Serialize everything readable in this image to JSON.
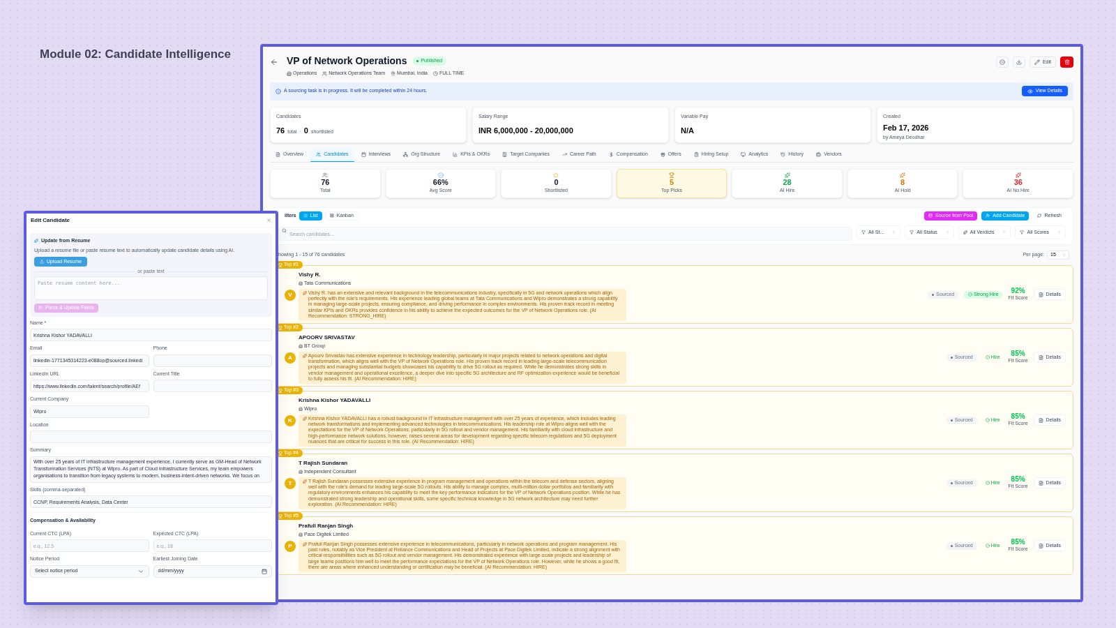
{
  "page_title": "Module 02: Candidate Intelligence",
  "job": {
    "title": "VP of Network Operations",
    "status": "Published",
    "meta": [
      {
        "kind": "department",
        "text": "Operations"
      },
      {
        "kind": "team",
        "text": "Network Operations Team"
      },
      {
        "kind": "location",
        "text": "Mumbai, India"
      },
      {
        "kind": "type",
        "text": "FULL TIME"
      }
    ],
    "edit_label": "Edit"
  },
  "banner": {
    "text": "A sourcing task is in progress. It will be completed within 24 hours.",
    "button": "View Details"
  },
  "info_cards": [
    {
      "kind": "counts",
      "label": "Candidates",
      "total": "76",
      "total_label": "total",
      "separator": "·",
      "shortlisted": "0",
      "shortlisted_label": "shortlisted"
    },
    {
      "kind": "value",
      "label": "Salary Range",
      "value": "INR 6,000,000 - 20,000,000"
    },
    {
      "kind": "value",
      "label": "Variable Pay",
      "value": "N/A"
    },
    {
      "kind": "dated",
      "label": "Created",
      "value": "Feb 17, 2026",
      "sub": "by Ameya Deodhar"
    }
  ],
  "tabs": [
    {
      "label": "Overview",
      "selected": false
    },
    {
      "label": "Candidates",
      "selected": true
    },
    {
      "label": "Interviews",
      "selected": false
    },
    {
      "label": "Org Structure",
      "selected": false
    },
    {
      "label": "KPIs & OKRs",
      "selected": false
    },
    {
      "label": "Target Companies",
      "selected": false
    },
    {
      "label": "Career Path",
      "selected": false
    },
    {
      "label": "Compensation",
      "selected": false
    },
    {
      "label": "Offers",
      "selected": false
    },
    {
      "label": "Hiring Setup",
      "selected": false
    },
    {
      "label": "Analytics",
      "selected": false
    },
    {
      "label": "History",
      "selected": false
    },
    {
      "label": "Vendors",
      "selected": false
    }
  ],
  "stats": [
    {
      "kind": "total",
      "value": "76",
      "label": "Total",
      "color": "#111827",
      "highlighted": false
    },
    {
      "kind": "score",
      "value": "66%",
      "label": "Avg Score",
      "color": "#111827",
      "highlighted": false
    },
    {
      "kind": "shortlisted",
      "value": "0",
      "label": "Shortlisted",
      "color": "#111827",
      "highlighted": false
    },
    {
      "kind": "top",
      "value": "5",
      "label": "Top Picks",
      "color": "#ca8a04",
      "highlighted": true
    },
    {
      "kind": "ai",
      "value": "28",
      "label": "AI Hire",
      "color": "#16a34a",
      "highlighted": false
    },
    {
      "kind": "ai",
      "value": "8",
      "label": "AI Hold",
      "color": "#d97706",
      "highlighted": false
    },
    {
      "kind": "ai",
      "value": "36",
      "label": "AI No Hire",
      "color": "#dc2626",
      "highlighted": false
    }
  ],
  "toolbar": {
    "filters_label": "ilters",
    "views": [
      {
        "label": "List",
        "selected": true
      },
      {
        "label": "Kanban",
        "selected": false
      }
    ],
    "actions": [
      {
        "kind": "source",
        "label": "Source from Pool"
      },
      {
        "kind": "add",
        "label": "Add Candidate"
      },
      {
        "kind": "refresh",
        "label": "Refresh"
      }
    ],
    "search_placeholder": "Search candidates...",
    "filters": [
      {
        "kind": "plain",
        "label": "All St..."
      },
      {
        "kind": "plain",
        "label": "All Status"
      },
      {
        "kind": "ai",
        "label": "All Verdicts"
      },
      {
        "kind": "plain",
        "label": "All Scores"
      }
    ]
  },
  "showing": "howing 1 - 15 of 76 candidates",
  "per_page": {
    "label": "Per page:",
    "value": "15"
  },
  "candidates": [
    {
      "rank": "Top #1",
      "initial": "V",
      "name": "Vishy R.",
      "company": "Tata Communications",
      "summary": "Vishy R. has an extensive and relevant background in the telecommunications industry, specifically in 5G and network operations which align perfectly with the role's requirements. His experience leading global teams at Tata Communications and Wipro demonstrates a strong capability in managing large-scale projects, ensuring compliance, and driving performance in complex environments. His proven track record in meeting similar KPIs and OKRs provides confidence in his ability to achieve the expected outcomes for the VP of Network Operations role. (AI Recommendation: STRONG_HIRE)",
      "status": "Sourced",
      "verdict": "Strong Hire",
      "strong": true,
      "score": "92%",
      "score_label": "Fit Score",
      "details": "Details"
    },
    {
      "rank": "Top #2",
      "initial": "A",
      "name": "APOORV SRIVASTAV",
      "company": "BT Group",
      "summary": "Apoorv Srivastav has extensive experience in technology leadership, particularly in major projects related to network operations and digital transformation, which aligns well with the VP of Network Operations role. His proven track record in leading large-scale telecommunication projects and managing substantial budgets showcases his capability to drive 5G rollout as required. While he demonstrates strong skills in vendor management and operational excellence, a deeper dive into specific 5G architecture and RF optimization experience would be beneficial to fully assess his fit. (AI Recommendation: HIRE)",
      "status": "Sourced",
      "verdict": "Hire",
      "strong": false,
      "score": "85%",
      "score_label": "Fit Score",
      "details": "Details"
    },
    {
      "rank": "Top #3",
      "initial": "K",
      "name": "Krishna Kishor YADAVALLI",
      "company": "Wipro",
      "summary": "Krishna Kishor YADAVALLI has a robust background in IT infrastructure management with over 25 years of experience, which includes leading network transformations and implementing advanced technologies in telecommunications. His leadership role at Wipro aligns well with the expectations for the VP of Network Operations, particularly in 5G rollout and vendor management. His familiarity with cloud infrastructure and high-performance network solutions, however, raises several areas for development regarding specific telecom regulations and 5G deployment nuances that are critical for success in this role. (AI Recommendation: HIRE)",
      "status": "Sourced",
      "verdict": "Hire",
      "strong": false,
      "score": "85%",
      "score_label": "Fit Score",
      "details": "Details"
    },
    {
      "rank": "Top #4",
      "initial": "T",
      "name": "T Rajish Sundaran",
      "company": "Independent Consultant",
      "summary": "T Rajish Sundaran possesses extensive experience in program management and operations within the telecom and defense sectors, aligning well with the role's demand for leading large-scale 5G rollouts. His ability to manage complex, multi-million dollar portfolios and familiarity with regulatory environments enhances his capability to meet the key performance indicators for the VP of Network Operations position. While he has demonstrated strong leadership and operational skills, some specific technical knowledge in 5G network architecture may need further exploration. (AI Recommendation: HIRE)",
      "status": "Sourced",
      "verdict": "Hire",
      "strong": false,
      "score": "85%",
      "score_label": "Fit Score",
      "details": "Details"
    },
    {
      "rank": "Top #5",
      "initial": "P",
      "name": "Prafull Ranjan Singh",
      "company": "Pace Digitek Limited",
      "summary": "Prafull Ranjan Singh possesses extensive experience in telecommunications, particularly in network operations and program management. His past roles, notably as Vice President at Reliance Communications and Head of Projects at Pace Digitek Limited, indicate a strong alignment with critical responsibilities such as 5G rollout and vendor management. His demonstrated experience with large-scale projects and leadership of large teams positions him well to meet the performance expectations for the VP of Network Operations role. However, while he shows a good fit, there are areas where enhanced understanding or certification may be beneficial. (AI Recommendation: HIRE)",
      "status": "Sourced",
      "verdict": "Hire",
      "strong": false,
      "score": "85%",
      "score_label": "Fit Score",
      "details": "Details"
    }
  ],
  "modal": {
    "title": "Edit Candidate",
    "resume": {
      "title": "Update from Resume",
      "text": "Upload a resume file or paste resume text to automatically update candidate details using AI.",
      "upload": "Upload Resume",
      "divider": "or paste text",
      "placeholder": "Paste resume content here...",
      "parse": "Parse & Update Fields",
      "parse_disabled": true
    },
    "fields": [
      {
        "kind": "input",
        "full_width": true,
        "label": "Name *",
        "value": "Krishna Kishor YADAVALLI"
      },
      {
        "kind": "input",
        "full_width": false,
        "label": "Email",
        "value": "linkedin-1771345314223-e088op@sourced.linkedi"
      },
      {
        "kind": "input",
        "full_width": false,
        "label": "Phone"
      },
      {
        "kind": "input",
        "full_width": false,
        "label": "LinkedIn URL",
        "value": "https://www.linkedin.com/talent/search/profile/AEf"
      },
      {
        "kind": "input",
        "full_width": false,
        "label": "Current Title"
      },
      {
        "kind": "input",
        "full_width": false,
        "label": "Current Company",
        "value": "Wipro"
      },
      {
        "kind": "input",
        "full_width": true,
        "label": "Location"
      },
      {
        "kind": "textarea",
        "full_width": true,
        "label": "Summary",
        "value": "With over 25 years of IT infrastructure management experience, I currently serve as GM-Head of Network Transformation Services (NTS) at Wipro. As part of Cloud Infrastructure Services, my team empowers organisations to transition from legacy systems to modern, business-intent-driven networks. We focus on"
      },
      {
        "kind": "input",
        "full_width": true,
        "label": "Skills (comma-separated)",
        "value": "CCNP, Requirements Analysis, Data Center"
      }
    ],
    "section_title": "Compensation & Availability",
    "compensation": [
      {
        "kind": "input",
        "full_width": false,
        "label": "Current CTC (LPA)",
        "placeholder": "e.g., 12.5"
      },
      {
        "kind": "input",
        "full_width": false,
        "label": "Expected CTC (LPA)",
        "placeholder": "e.g., 18"
      },
      {
        "kind": "select",
        "full_width": false,
        "label": "Notice Period",
        "value": "Select notice period"
      },
      {
        "kind": "date",
        "full_width": false,
        "label": "Earliest Joining Date",
        "value": "dd/mm/yyyy"
      }
    ]
  }
}
